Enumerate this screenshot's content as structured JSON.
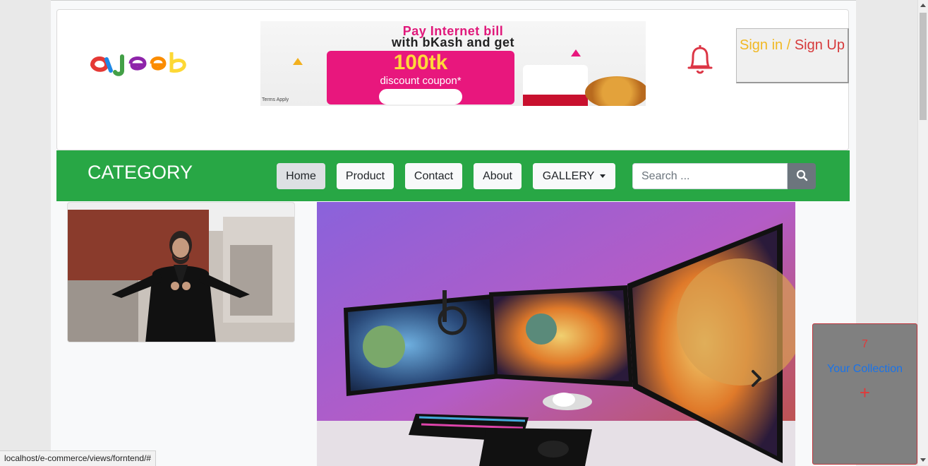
{
  "header": {
    "logo_text": "ajeeb",
    "banner": {
      "line1": "Pay Internet bill",
      "line2": "with bKash and get",
      "amount": "100tk",
      "subtitle": "discount coupon*",
      "fine_print": "Terms Apply"
    },
    "bell_icon": "bell-icon",
    "sign_in": "Sign in",
    "separator": " / ",
    "sign_up": "Sign Up"
  },
  "nav": {
    "category": "CATEGORY",
    "items": [
      "Home",
      "Product",
      "Contact",
      "About"
    ],
    "gallery": "GALLERY",
    "search_placeholder": "Search ...",
    "search_icon": "search-icon"
  },
  "collection": {
    "count": "7",
    "label": "Your Collection",
    "plus": "+"
  },
  "status_bar": {
    "url": "localhost/e-commerce/views/forntend/#"
  },
  "colors": {
    "navbar": "#28a745",
    "sign_in": "#f1b823",
    "sign_up": "#d6393a",
    "collection_bg": "#808080"
  }
}
